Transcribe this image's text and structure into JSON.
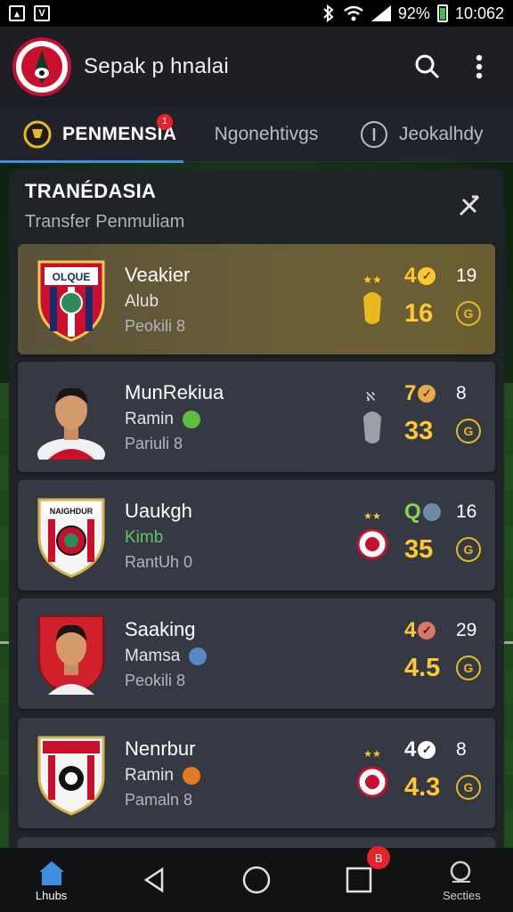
{
  "status_bar": {
    "battery": "92%",
    "time": "10:062",
    "left_icon_2": "V"
  },
  "app_bar": {
    "title": "Sepak p hnalai"
  },
  "tabs": [
    {
      "label": "PENMENSIA",
      "badge": "1"
    },
    {
      "label": "Ngonehtivgs"
    },
    {
      "label": "Jeokalhdy"
    }
  ],
  "panel": {
    "title": "TRANÉDASIA",
    "subtitle": "Transfer Penmuliam"
  },
  "players": [
    {
      "name": "Veakier",
      "club": "Alub",
      "position": "Peokili 8",
      "stat_top": "4",
      "stat_side": "19",
      "stat_main": "16",
      "coin": "G",
      "highlight": true
    },
    {
      "name": "MunRekiua",
      "club": "Ramin",
      "position": "Pariuli 8",
      "stat_top": "7",
      "stat_side": "8",
      "stat_main": "33",
      "coin": "G",
      "highlight": false
    },
    {
      "name": "Uaukgh",
      "club": "Kimb",
      "position": "RantUh 0",
      "stat_top": "Q",
      "stat_side": "16",
      "stat_main": "35",
      "coin": "G",
      "highlight": false
    },
    {
      "name": "Saaking",
      "club": "Mamsa",
      "position": "Peokili 8",
      "stat_top": "4",
      "stat_side": "29",
      "stat_main": "4.5",
      "coin": "G",
      "highlight": false
    },
    {
      "name": "Nenrbur",
      "club": "Ramin",
      "position": "Pamaln 8",
      "stat_top": "4",
      "stat_side": "8",
      "stat_main": "4.3",
      "coin": "G",
      "highlight": false
    }
  ],
  "crest_texts": {
    "crest_1": "OLQUE",
    "crest_3": "NAIGHDUR"
  },
  "bottom_nav": {
    "home_label": "Lhubs",
    "recents_badge": "B",
    "search_label": "Secties"
  },
  "colors": {
    "accent": "#3d8fe0",
    "gold": "#ffc832",
    "card": "#343943",
    "highlight": "#6b5f37",
    "red": "#c8102e"
  }
}
